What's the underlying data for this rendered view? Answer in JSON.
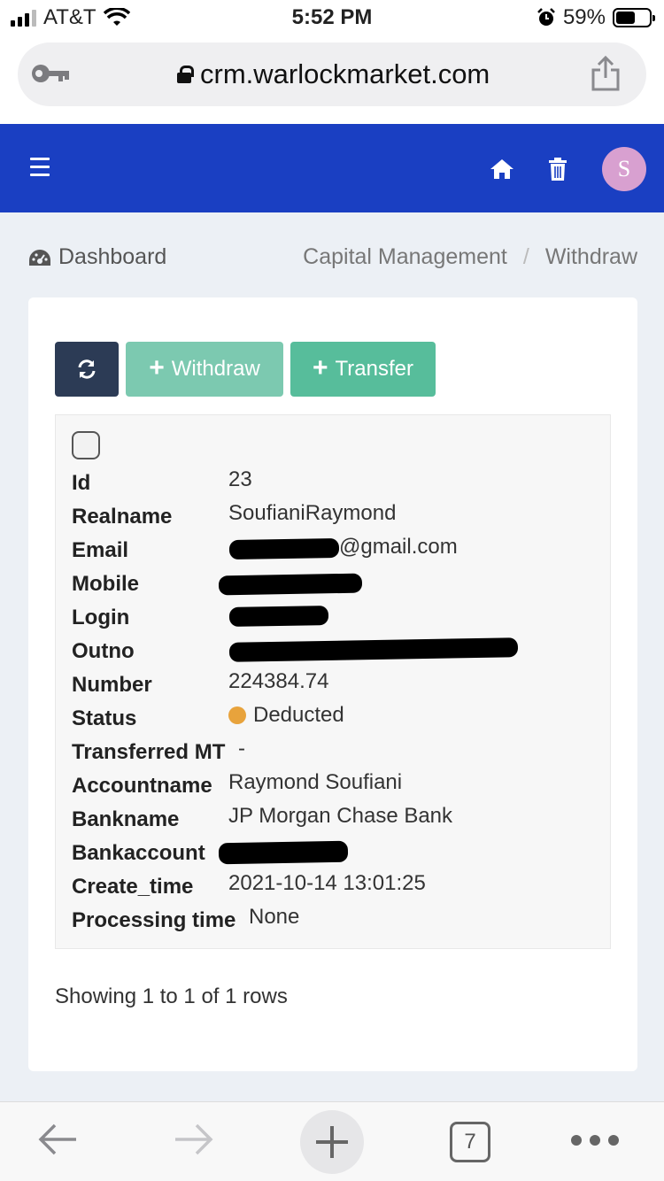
{
  "status_bar": {
    "carrier": "AT&T",
    "time": "5:52 PM",
    "battery": "59%",
    "battery_level": 0.59
  },
  "browser": {
    "url": "crm.warlockmarket.com",
    "tab_count": "7"
  },
  "app_header": {
    "avatar_letter": "S"
  },
  "breadcrumb": {
    "dashboard": "Dashboard",
    "section": "Capital Management",
    "separator": "/",
    "current": "Withdraw"
  },
  "toolbar": {
    "withdraw_label": "Withdraw",
    "transfer_label": "Transfer"
  },
  "record": {
    "labels": {
      "id": "Id",
      "realname": "Realname",
      "email": "Email",
      "mobile": "Mobile",
      "login": "Login",
      "outno": "Outno",
      "number": "Number",
      "status": "Status",
      "transferred": "Transferred MT",
      "accountname": "Accountname",
      "bankname": "Bankname",
      "bankaccount": "Bankaccount",
      "create_time": "Create_time",
      "processing_time": "Processing time"
    },
    "values": {
      "id": "23",
      "realname": "SoufianiRaymond",
      "email_visible": "@gmail.com",
      "number": "224384.74",
      "status": "Deducted",
      "transferred": "-",
      "accountname": "Raymond Soufiani",
      "bankname": "JP Morgan Chase Bank",
      "create_time": "2021-10-14 13:01:25",
      "processing_time": "None"
    }
  },
  "pagination": {
    "summary": "Showing 1 to 1 of 1 rows"
  },
  "colors": {
    "header_blue": "#1a3fc2",
    "status_orange": "#e8a33c",
    "transfer_green": "#57bd9b",
    "refresh_dark": "#2c3b55"
  }
}
